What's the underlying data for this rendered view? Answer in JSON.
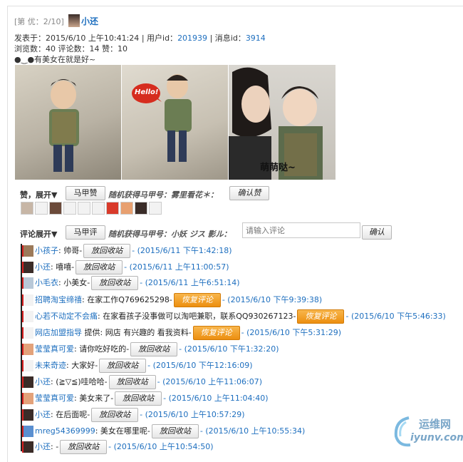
{
  "header": {
    "floor_label": "[第 优：2/10]",
    "author": "小还",
    "posted_line": "发表于：2015/6/10 上午10:41:24",
    "userid_label": "| 用户id：",
    "userid": "201939",
    "msgid_label": "| 消息id：",
    "msgid": "3914",
    "stats": "浏览数：40 评论数：14 赞：10",
    "message": "●‿●有美女在就是好~"
  },
  "photos": {
    "caption_bubble": "Hello!",
    "caption_overlay": "萌萌哒~"
  },
  "likes": {
    "toggle_label": "赞，展开▼",
    "alias_button": "马甲赞",
    "random_label": "随机获得马甲号：雾里看花＊：",
    "confirm_button": "确认赞"
  },
  "comments_bar": {
    "toggle_label": "评论展开▼",
    "alias_button": "马甲评",
    "random_label": "随机获得马甲号：小妖 ジス 影ル：",
    "input_placeholder": "请输入评论",
    "confirm_button": "确认"
  },
  "comments": [
    {
      "name": "小孩子",
      "text": ": 帅哥-",
      "button": "放回收站",
      "time": "- (2015/6/11 下午1:42:18)",
      "orange": false
    },
    {
      "name": "小还",
      "text": ": 嘻嘻-",
      "button": "放回收站",
      "time": "- (2015/6/11 上午11:00:57)",
      "orange": false
    },
    {
      "name": "小毛衣",
      "text": ": 小美女-",
      "button": "放回收站",
      "time": "- (2015/6/11 上午6:51:14)",
      "orange": false
    },
    {
      "name": "招聘淘宝缔禧",
      "text": ": 在家工作Q769625298-",
      "button": "恢复评论",
      "time": "- (2015/6/10 下午9:39:38)",
      "orange": true
    },
    {
      "name": "心若不动定不会痛",
      "text": ": 在家看孩子没事做可以淘吧兼职，联系QQ930267123-",
      "button": "恢复评论",
      "time": "- (2015/6/10 下午5:46:33)",
      "orange": true
    },
    {
      "name": "网店加盟指导",
      "text": " 提供: 网店 有兴趣的 看我资料-",
      "button": "恢复评论",
      "time": "- (2015/6/10 下午5:31:29)",
      "orange": true
    },
    {
      "name": "莹莹真可爱",
      "text": ": 请你吃好吃的-",
      "button": "放回收站",
      "time": "- (2015/6/10 下午1:32:20)",
      "orange": false
    },
    {
      "name": "未来奇迹",
      "text": ": 大家好-",
      "button": "放回收站",
      "time": "- (2015/6/10 下午12:16:09)",
      "orange": false
    },
    {
      "name": "小还",
      "text": ": (≧▽≦)哇哈哈-",
      "button": "放回收站",
      "time": "- (2015/6/10 上午11:06:07)",
      "orange": false
    },
    {
      "name": "莹莹真可爱",
      "text": ": 美女来了-",
      "button": "放回收站",
      "time": "- (2015/6/10 上午11:04:40)",
      "orange": false
    },
    {
      "name": "小还",
      "text": ": 在后面呢-",
      "button": "放回收站",
      "time": "- (2015/6/10 上午10:57:29)",
      "orange": false
    },
    {
      "name": "mreg54369999",
      "text": ": 美女在哪里呢-",
      "button": "放回收站",
      "time": "- (2015/6/10 上午10:55:34)",
      "orange": false
    },
    {
      "name": "小还",
      "text": ": -",
      "button": "放回收站",
      "time": "- (2015/6/10 上午10:54:50)",
      "orange": false
    }
  ],
  "watermark": {
    "title": "运维网",
    "url": "iyunv.com"
  },
  "colors": {
    "link": "#1e6fbf",
    "orange_button": "#ec8f10",
    "comment_marker": "#d81f1f"
  }
}
